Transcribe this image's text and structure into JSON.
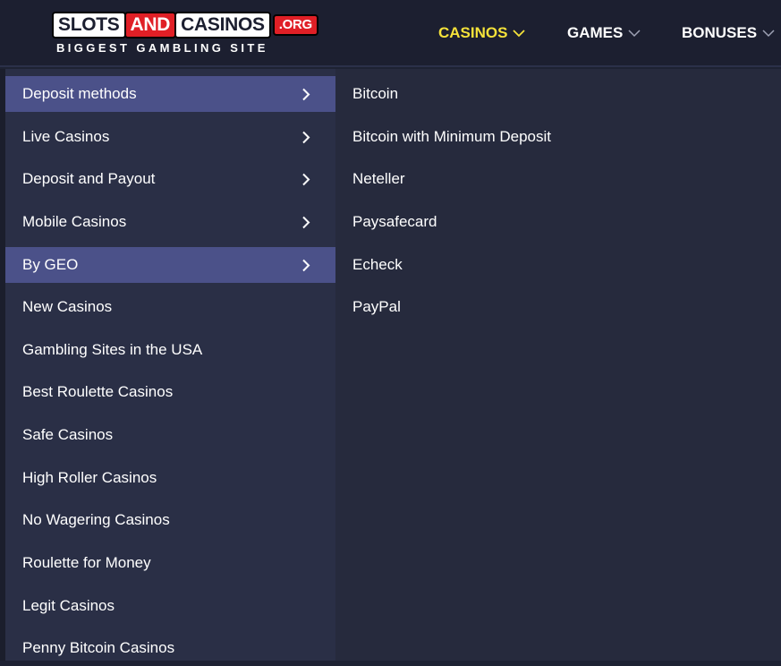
{
  "logo": {
    "part1": "SLOTS",
    "part2": "AND",
    "part3": "CASINOS",
    "part4": ".ORG",
    "tagline": "BIGGEST GAMBLING SITE"
  },
  "nav": {
    "items": [
      {
        "label": "CASINOS",
        "active": true
      },
      {
        "label": "GAMES",
        "active": false
      },
      {
        "label": "BONUSES",
        "active": false
      }
    ]
  },
  "menu": {
    "left_items": [
      {
        "label": "Deposit methods",
        "has_submenu": true,
        "highlighted": true
      },
      {
        "label": "Live Casinos",
        "has_submenu": true,
        "highlighted": false
      },
      {
        "label": "Deposit and Payout",
        "has_submenu": true,
        "highlighted": false
      },
      {
        "label": "Mobile Casinos",
        "has_submenu": true,
        "highlighted": false
      },
      {
        "label": "By GEO",
        "has_submenu": true,
        "highlighted": true
      },
      {
        "label": "New Casinos",
        "has_submenu": false,
        "highlighted": false
      },
      {
        "label": "Gambling Sites in the USA",
        "has_submenu": false,
        "highlighted": false
      },
      {
        "label": "Best Roulette Casinos",
        "has_submenu": false,
        "highlighted": false
      },
      {
        "label": "Safe Casinos",
        "has_submenu": false,
        "highlighted": false
      },
      {
        "label": "High Roller Casinos",
        "has_submenu": false,
        "highlighted": false
      },
      {
        "label": "No Wagering Casinos",
        "has_submenu": false,
        "highlighted": false
      },
      {
        "label": "Roulette for Money",
        "has_submenu": false,
        "highlighted": false
      },
      {
        "label": "Legit Casinos",
        "has_submenu": false,
        "highlighted": false
      },
      {
        "label": "Penny Bitcoin Casinos",
        "has_submenu": false,
        "highlighted": false
      }
    ],
    "submenu_items": [
      {
        "label": "Bitcoin"
      },
      {
        "label": "Bitcoin with Minimum Deposit"
      },
      {
        "label": "Neteller"
      },
      {
        "label": "Paysafecard"
      },
      {
        "label": "Echeck"
      },
      {
        "label": "PayPal"
      }
    ]
  },
  "colors": {
    "header_bg": "#1c1f30",
    "menu_bg": "#2a2f46",
    "submenu_bg": "#262a3d",
    "highlight_bg": "#4b5189",
    "active_nav": "#f5e23a",
    "logo_red": "#e01f26"
  }
}
